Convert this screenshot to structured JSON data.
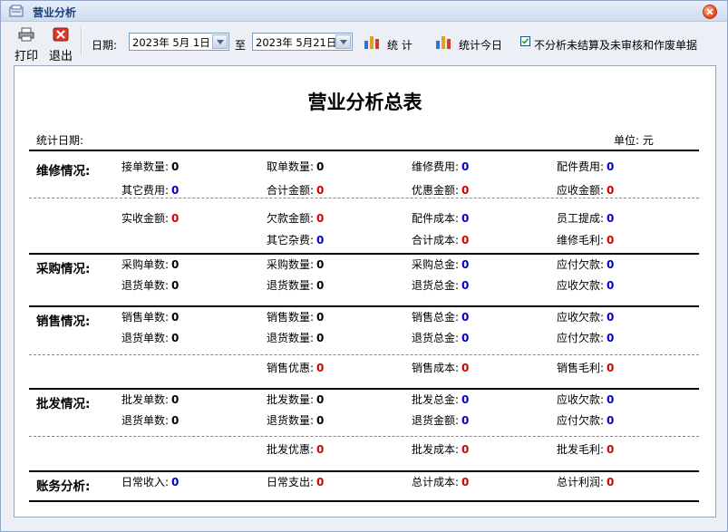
{
  "window": {
    "title": "营业分析"
  },
  "toolbar": {
    "print_label": "打印",
    "exit_label": "退出",
    "date_label": "日期:",
    "start_date": "2023年 5月 1日",
    "to_label": "至",
    "end_date": "2023年 5月21日",
    "stat_label": "统 计",
    "stat_today_label": "统计今日",
    "filter_checkbox_label": "不分析未结算及未审核和作废单据",
    "filter_checked": true
  },
  "report": {
    "title": "营业分析总表",
    "stat_date_label": "统计日期:",
    "unit_label": "单位: 元",
    "sections": [
      {
        "title": "维修情况:",
        "rows": [
          [
            {
              "label": "接单数量:",
              "value": "0",
              "color": "black"
            },
            {
              "label": "取单数量:",
              "value": "0",
              "color": "black"
            },
            {
              "label": "维修费用:",
              "value": "0",
              "color": "blue"
            },
            {
              "label": "配件费用:",
              "value": "0",
              "color": "blue"
            }
          ],
          [
            {
              "label": "其它费用:",
              "value": "0",
              "color": "blue"
            },
            {
              "label": "合计金额:",
              "value": "0",
              "color": "red"
            },
            {
              "label": "优惠金额:",
              "value": "0",
              "color": "red"
            },
            {
              "label": "应收金额:",
              "value": "0",
              "color": "red"
            }
          ],
          [
            {
              "label": "实收金额:",
              "value": "0",
              "color": "red"
            },
            {
              "label": "欠款金额:",
              "value": "0",
              "color": "red"
            },
            {
              "label": "配件成本:",
              "value": "0",
              "color": "blue"
            },
            {
              "label": "员工提成:",
              "value": "0",
              "color": "blue"
            }
          ],
          [
            null,
            {
              "label": "其它杂费:",
              "value": "0",
              "color": "blue"
            },
            {
              "label": "合计成本:",
              "value": "0",
              "color": "red"
            },
            {
              "label": "维修毛利:",
              "value": "0",
              "color": "red"
            }
          ]
        ]
      },
      {
        "title": "采购情况:",
        "rows": [
          [
            {
              "label": "采购单数:",
              "value": "0",
              "color": "black"
            },
            {
              "label": "采购数量:",
              "value": "0",
              "color": "black"
            },
            {
              "label": "采购总金:",
              "value": "0",
              "color": "blue"
            },
            {
              "label": "应付欠款:",
              "value": "0",
              "color": "blue"
            }
          ],
          [
            {
              "label": "退货单数:",
              "value": "0",
              "color": "black"
            },
            {
              "label": "退货数量:",
              "value": "0",
              "color": "black"
            },
            {
              "label": "退货总金:",
              "value": "0",
              "color": "blue"
            },
            {
              "label": "应收欠款:",
              "value": "0",
              "color": "blue"
            }
          ]
        ]
      },
      {
        "title": "销售情况:",
        "rows": [
          [
            {
              "label": "销售单数:",
              "value": "0",
              "color": "black"
            },
            {
              "label": "销售数量:",
              "value": "0",
              "color": "black"
            },
            {
              "label": "销售总金:",
              "value": "0",
              "color": "blue"
            },
            {
              "label": "应收欠款:",
              "value": "0",
              "color": "blue"
            }
          ],
          [
            {
              "label": "退货单数:",
              "value": "0",
              "color": "black"
            },
            {
              "label": "退货数量:",
              "value": "0",
              "color": "black"
            },
            {
              "label": "退货总金:",
              "value": "0",
              "color": "blue"
            },
            {
              "label": "应付欠款:",
              "value": "0",
              "color": "blue"
            }
          ],
          [
            null,
            {
              "label": "销售优惠:",
              "value": "0",
              "color": "red"
            },
            {
              "label": "销售成本:",
              "value": "0",
              "color": "red"
            },
            {
              "label": "销售毛利:",
              "value": "0",
              "color": "red"
            }
          ]
        ]
      },
      {
        "title": "批发情况:",
        "rows": [
          [
            {
              "label": "批发单数:",
              "value": "0",
              "color": "black"
            },
            {
              "label": "批发数量:",
              "value": "0",
              "color": "black"
            },
            {
              "label": "批发总金:",
              "value": "0",
              "color": "blue"
            },
            {
              "label": "应收欠款:",
              "value": "0",
              "color": "blue"
            }
          ],
          [
            {
              "label": "退货单数:",
              "value": "0",
              "color": "black"
            },
            {
              "label": "退货数量:",
              "value": "0",
              "color": "black"
            },
            {
              "label": "退货金额:",
              "value": "0",
              "color": "blue"
            },
            {
              "label": "应付欠款:",
              "value": "0",
              "color": "blue"
            }
          ],
          [
            null,
            {
              "label": "批发优惠:",
              "value": "0",
              "color": "red"
            },
            {
              "label": "批发成本:",
              "value": "0",
              "color": "red"
            },
            {
              "label": "批发毛利:",
              "value": "0",
              "color": "red"
            }
          ]
        ]
      },
      {
        "title": "账务分析:",
        "rows": [
          [
            {
              "label": "日常收入:",
              "value": "0",
              "color": "blue"
            },
            {
              "label": "日常支出:",
              "value": "0",
              "color": "red"
            },
            {
              "label": "总计成本:",
              "value": "0",
              "color": "red"
            },
            {
              "label": "总计利润:",
              "value": "0",
              "color": "red"
            }
          ]
        ]
      }
    ]
  }
}
